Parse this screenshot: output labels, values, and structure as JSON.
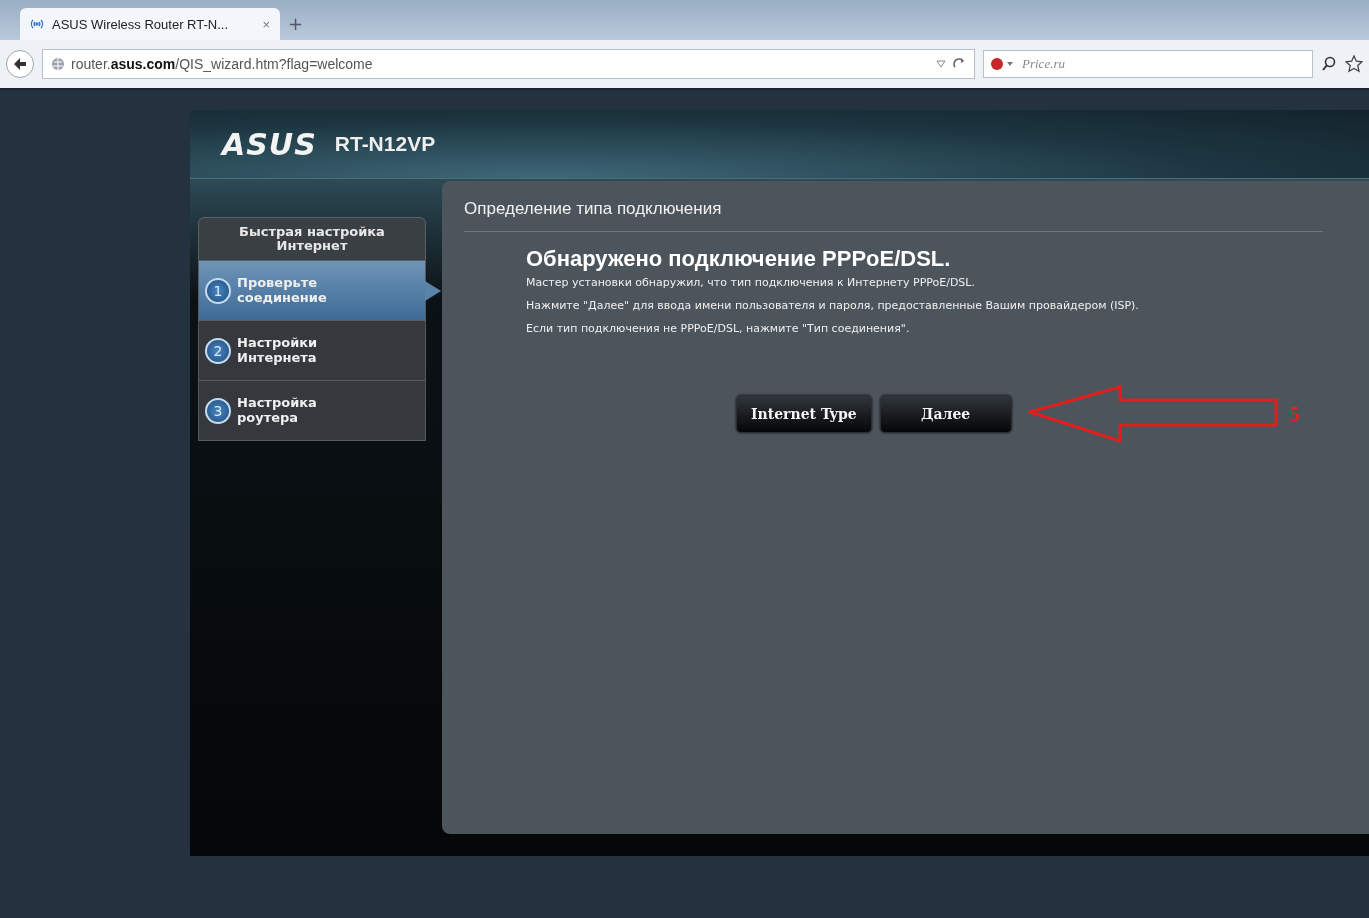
{
  "browser": {
    "tab": {
      "title": "ASUS Wireless Router RT-N...",
      "close": "×",
      "selected": true
    },
    "new_tab": "+",
    "url": "router.**asus.com**/QIS_wizard.htm?flag=welcome",
    "search": {
      "placeholder": "Price.ru"
    }
  },
  "router": {
    "brand": "ASUS",
    "model": "RT-N12VP",
    "sidebar": {
      "title": "Быстрая настройка Интернет",
      "steps": [
        {
          "number": "1",
          "label": "Проверьте соединение",
          "selected": true
        },
        {
          "number": "2",
          "label": "Настройки Интернета",
          "selected": false
        },
        {
          "number": "3",
          "label": "Настройка роутера",
          "selected": false
        }
      ]
    },
    "panel": {
      "title": "Определение типа подключения",
      "heading": "Обнаружено подключение PPPoE/DSL.",
      "paragraphs": [
        "Мастер установки обнаружил, что тип подключения к Интернету PPPoE/DSL.",
        "Нажмите \"Далее\" для ввода имени пользователя и пароля, предоставленные Вашим провайдером (ISP).",
        "Если тип подключения не PPPoE/DSL, нажмите \"Тип соединения\"."
      ],
      "buttons": [
        "Internet Type",
        "Далее"
      ]
    }
  },
  "annotation": {
    "label": "5"
  }
}
